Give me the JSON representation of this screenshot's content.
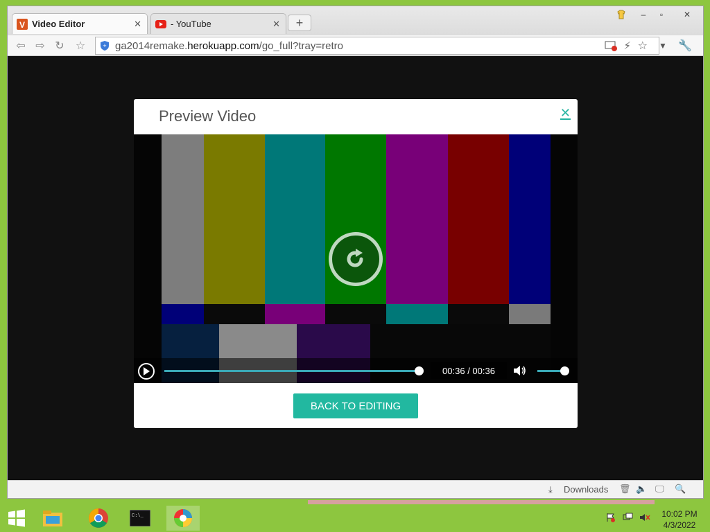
{
  "browser": {
    "tabs": [
      {
        "label": "Video Editor",
        "favicon": "video-editor-icon"
      },
      {
        "label": "- YouTube",
        "favicon": "youtube-icon"
      }
    ],
    "new_tab": "+",
    "window_controls": {
      "minimize": "–",
      "restore": "▫",
      "close": "✕"
    },
    "url_prefix": "ga2014remake.",
    "url_host": "herokuapp.com",
    "url_path": "/go_full?tray=retro"
  },
  "modal": {
    "title": "Preview Video",
    "close_label": "✕",
    "video": {
      "time": "00:36 / 00:36",
      "progress_fraction": 1.0,
      "volume_fraction": 1.0
    },
    "back_button": "BACK TO EDITING"
  },
  "statusbar": {
    "downloads": "Downloads"
  },
  "taskbar": {
    "clock_time": "10:02 PM",
    "clock_date": "4/3/2022"
  },
  "colors": {
    "accent": "#22b8a0",
    "desktop": "#8dc63f",
    "page_bg": "#111111"
  }
}
